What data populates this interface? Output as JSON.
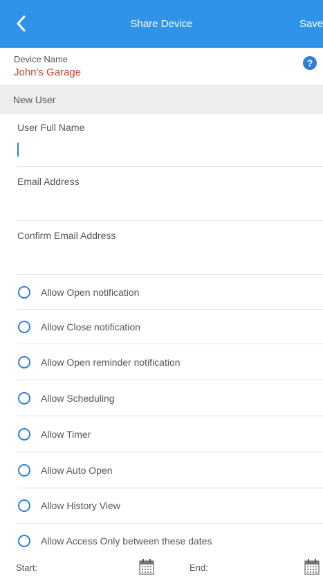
{
  "header": {
    "title": "Share Device",
    "save_label": "Save",
    "accent_color": "#2f93e8"
  },
  "device": {
    "label": "Device Name",
    "value": "John's Garage",
    "value_color": "#c0452d"
  },
  "section": {
    "new_user": "New User"
  },
  "fields": {
    "full_name": {
      "label": "User Full Name",
      "value": ""
    },
    "email": {
      "label": "Email Address",
      "value": ""
    },
    "confirm_email": {
      "label": "Confirm Email Address",
      "value": ""
    }
  },
  "options": [
    {
      "label": "Allow Open notification",
      "checked": false
    },
    {
      "label": "Allow Close notification",
      "checked": false
    },
    {
      "label": "Allow Open reminder notification",
      "checked": false
    },
    {
      "label": "Allow Scheduling",
      "checked": false
    },
    {
      "label": "Allow Timer",
      "checked": false
    },
    {
      "label": "Allow Auto Open",
      "checked": false
    },
    {
      "label": "Allow History View",
      "checked": false
    },
    {
      "label": "Allow Access Only between these dates",
      "checked": false
    }
  ],
  "dates": {
    "start_label": "Start:",
    "end_label": "End:"
  },
  "icons": [
    "back-chevron-icon",
    "help-question-icon",
    "radio-unchecked-icon",
    "calendar-icon"
  ]
}
